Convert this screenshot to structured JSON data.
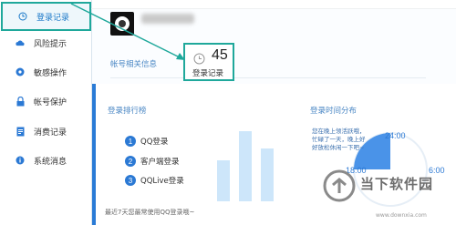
{
  "sidebar": {
    "items": [
      {
        "label": "登录记录",
        "icon": "clock-icon",
        "active": true
      },
      {
        "label": "风险提示",
        "icon": "cloud-icon",
        "active": false
      },
      {
        "label": "敏感操作",
        "icon": "gear-icon",
        "active": false
      },
      {
        "label": "帐号保护",
        "icon": "lock-icon",
        "active": false
      },
      {
        "label": "消费记录",
        "icon": "receipt-icon",
        "active": false
      },
      {
        "label": "系统消息",
        "icon": "info-icon",
        "active": false
      }
    ]
  },
  "header": {
    "section_title": "帐号相关信息",
    "record_count": "45",
    "record_label": "登录记录"
  },
  "ranking": {
    "title": "登录排行榜",
    "items": [
      {
        "num": "1",
        "label": "QQ登录"
      },
      {
        "num": "2",
        "label": "客户端登录"
      },
      {
        "num": "3",
        "label": "QQLive登录"
      }
    ],
    "footnote": "最近7天您最常使用QQ登录哦~"
  },
  "time_dist": {
    "title": "登录时间分布",
    "note": "您在晚上领活跃哦，忙碌了一天，晚上好好放松休闲一下吧~",
    "t_top": "24:00",
    "t_left": "18:00",
    "t_right": "6:00"
  },
  "watermark": {
    "text": "当下软件园",
    "url": "www.downxia.com"
  },
  "colors": {
    "accent": "#1fa89b",
    "blue": "#2b79d4",
    "bar": "#cde6fa",
    "pie": "#4a93e8"
  }
}
